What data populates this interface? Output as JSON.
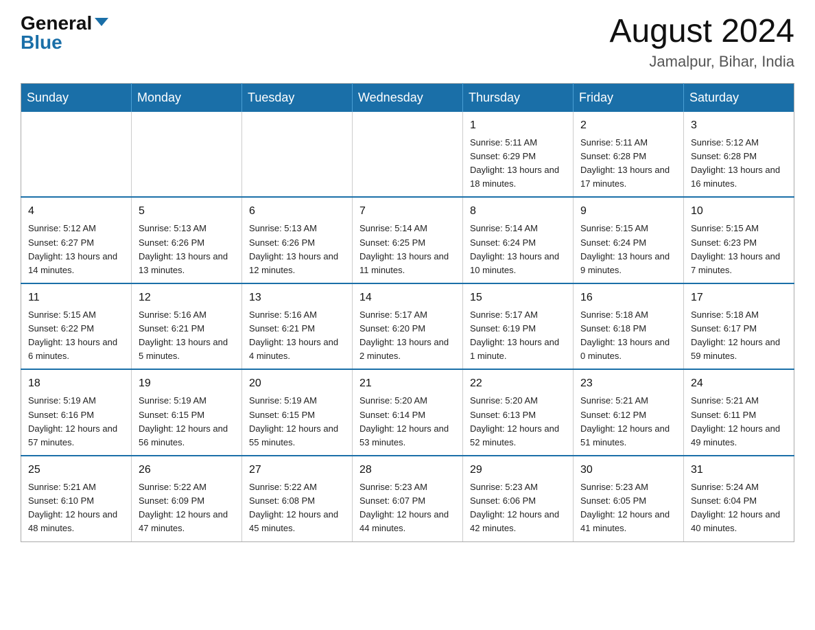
{
  "header": {
    "logo_general": "General",
    "logo_blue": "Blue",
    "month_title": "August 2024",
    "location": "Jamalpur, Bihar, India"
  },
  "days_of_week": [
    "Sunday",
    "Monday",
    "Tuesday",
    "Wednesday",
    "Thursday",
    "Friday",
    "Saturday"
  ],
  "weeks": [
    [
      {
        "day": "",
        "info": ""
      },
      {
        "day": "",
        "info": ""
      },
      {
        "day": "",
        "info": ""
      },
      {
        "day": "",
        "info": ""
      },
      {
        "day": "1",
        "info": "Sunrise: 5:11 AM\nSunset: 6:29 PM\nDaylight: 13 hours and 18 minutes."
      },
      {
        "day": "2",
        "info": "Sunrise: 5:11 AM\nSunset: 6:28 PM\nDaylight: 13 hours and 17 minutes."
      },
      {
        "day": "3",
        "info": "Sunrise: 5:12 AM\nSunset: 6:28 PM\nDaylight: 13 hours and 16 minutes."
      }
    ],
    [
      {
        "day": "4",
        "info": "Sunrise: 5:12 AM\nSunset: 6:27 PM\nDaylight: 13 hours and 14 minutes."
      },
      {
        "day": "5",
        "info": "Sunrise: 5:13 AM\nSunset: 6:26 PM\nDaylight: 13 hours and 13 minutes."
      },
      {
        "day": "6",
        "info": "Sunrise: 5:13 AM\nSunset: 6:26 PM\nDaylight: 13 hours and 12 minutes."
      },
      {
        "day": "7",
        "info": "Sunrise: 5:14 AM\nSunset: 6:25 PM\nDaylight: 13 hours and 11 minutes."
      },
      {
        "day": "8",
        "info": "Sunrise: 5:14 AM\nSunset: 6:24 PM\nDaylight: 13 hours and 10 minutes."
      },
      {
        "day": "9",
        "info": "Sunrise: 5:15 AM\nSunset: 6:24 PM\nDaylight: 13 hours and 9 minutes."
      },
      {
        "day": "10",
        "info": "Sunrise: 5:15 AM\nSunset: 6:23 PM\nDaylight: 13 hours and 7 minutes."
      }
    ],
    [
      {
        "day": "11",
        "info": "Sunrise: 5:15 AM\nSunset: 6:22 PM\nDaylight: 13 hours and 6 minutes."
      },
      {
        "day": "12",
        "info": "Sunrise: 5:16 AM\nSunset: 6:21 PM\nDaylight: 13 hours and 5 minutes."
      },
      {
        "day": "13",
        "info": "Sunrise: 5:16 AM\nSunset: 6:21 PM\nDaylight: 13 hours and 4 minutes."
      },
      {
        "day": "14",
        "info": "Sunrise: 5:17 AM\nSunset: 6:20 PM\nDaylight: 13 hours and 2 minutes."
      },
      {
        "day": "15",
        "info": "Sunrise: 5:17 AM\nSunset: 6:19 PM\nDaylight: 13 hours and 1 minute."
      },
      {
        "day": "16",
        "info": "Sunrise: 5:18 AM\nSunset: 6:18 PM\nDaylight: 13 hours and 0 minutes."
      },
      {
        "day": "17",
        "info": "Sunrise: 5:18 AM\nSunset: 6:17 PM\nDaylight: 12 hours and 59 minutes."
      }
    ],
    [
      {
        "day": "18",
        "info": "Sunrise: 5:19 AM\nSunset: 6:16 PM\nDaylight: 12 hours and 57 minutes."
      },
      {
        "day": "19",
        "info": "Sunrise: 5:19 AM\nSunset: 6:15 PM\nDaylight: 12 hours and 56 minutes."
      },
      {
        "day": "20",
        "info": "Sunrise: 5:19 AM\nSunset: 6:15 PM\nDaylight: 12 hours and 55 minutes."
      },
      {
        "day": "21",
        "info": "Sunrise: 5:20 AM\nSunset: 6:14 PM\nDaylight: 12 hours and 53 minutes."
      },
      {
        "day": "22",
        "info": "Sunrise: 5:20 AM\nSunset: 6:13 PM\nDaylight: 12 hours and 52 minutes."
      },
      {
        "day": "23",
        "info": "Sunrise: 5:21 AM\nSunset: 6:12 PM\nDaylight: 12 hours and 51 minutes."
      },
      {
        "day": "24",
        "info": "Sunrise: 5:21 AM\nSunset: 6:11 PM\nDaylight: 12 hours and 49 minutes."
      }
    ],
    [
      {
        "day": "25",
        "info": "Sunrise: 5:21 AM\nSunset: 6:10 PM\nDaylight: 12 hours and 48 minutes."
      },
      {
        "day": "26",
        "info": "Sunrise: 5:22 AM\nSunset: 6:09 PM\nDaylight: 12 hours and 47 minutes."
      },
      {
        "day": "27",
        "info": "Sunrise: 5:22 AM\nSunset: 6:08 PM\nDaylight: 12 hours and 45 minutes."
      },
      {
        "day": "28",
        "info": "Sunrise: 5:23 AM\nSunset: 6:07 PM\nDaylight: 12 hours and 44 minutes."
      },
      {
        "day": "29",
        "info": "Sunrise: 5:23 AM\nSunset: 6:06 PM\nDaylight: 12 hours and 42 minutes."
      },
      {
        "day": "30",
        "info": "Sunrise: 5:23 AM\nSunset: 6:05 PM\nDaylight: 12 hours and 41 minutes."
      },
      {
        "day": "31",
        "info": "Sunrise: 5:24 AM\nSunset: 6:04 PM\nDaylight: 12 hours and 40 minutes."
      }
    ]
  ]
}
